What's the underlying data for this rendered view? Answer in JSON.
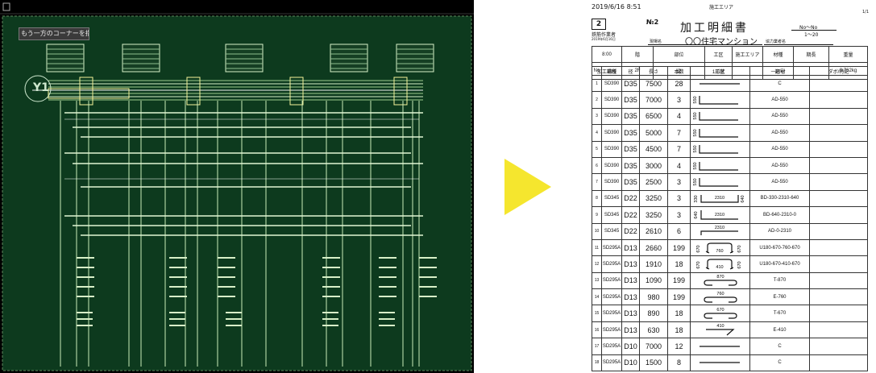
{
  "cad": {
    "prompt": "もう一方のコーナーを指定:",
    "grid_label": "Y1",
    "colors": {
      "background": "#0d3a1e",
      "lines": "#b9e2a8",
      "highlight": "#f5f39a"
    }
  },
  "doc": {
    "datetime": "2019/6/16 8:51",
    "area_label": "施工エリア",
    "page": "1/1",
    "sheet_no": "2",
    "sheet_sub": "鉄筋作業者",
    "sheet_date": "2019年6月16日",
    "num_label": "№2",
    "title": "加工明細書",
    "range_label": "No〜No",
    "range_value": "1〜20",
    "site_label": "現場名",
    "site_name": "〇〇住宅マンション",
    "partner_label": "協力業者名",
    "info_rows": [
      [
        "8:00",
        "階",
        "部位",
        "工区",
        "施工エリア",
        "材種",
        "期長",
        "重量"
      ],
      [
        "加工場所",
        "2F",
        "梁",
        "1工区",
        "",
        "一般材",
        "",
        "3,762kg"
      ]
    ],
    "columns": [
      "No",
      "鋼種",
      "径",
      "長さ",
      "本数",
      "形状",
      "記号",
      "ダボ/特記"
    ],
    "rows": [
      {
        "no": "1",
        "steel": "SD390",
        "dia": "D35",
        "length": "7500",
        "count": "28",
        "shape": "straight",
        "code": "C"
      },
      {
        "no": "2",
        "steel": "SD390",
        "dia": "D35",
        "length": "7000",
        "count": "3",
        "shape": "hook",
        "dim": "550",
        "code": "AD-550"
      },
      {
        "no": "3",
        "steel": "SD390",
        "dia": "D35",
        "length": "6500",
        "count": "4",
        "shape": "hook",
        "dim": "550",
        "code": "AD-550"
      },
      {
        "no": "4",
        "steel": "SD390",
        "dia": "D35",
        "length": "5000",
        "count": "7",
        "shape": "hook",
        "dim": "550",
        "code": "AD-550"
      },
      {
        "no": "5",
        "steel": "SD390",
        "dia": "D35",
        "length": "4500",
        "count": "7",
        "shape": "hook",
        "dim": "550",
        "code": "AD-550"
      },
      {
        "no": "6",
        "steel": "SD390",
        "dia": "D35",
        "length": "3000",
        "count": "4",
        "shape": "hook",
        "dim": "550",
        "code": "AD-550"
      },
      {
        "no": "7",
        "steel": "SD390",
        "dia": "D35",
        "length": "2500",
        "count": "3",
        "shape": "hook",
        "dim": "550",
        "code": "AD-550"
      },
      {
        "no": "8",
        "steel": "SD345",
        "dia": "D22",
        "length": "3250",
        "count": "3",
        "shape": "u",
        "dim": "2310",
        "dim_l": "330",
        "dim_r": "640",
        "code": "BD-330-2310-640"
      },
      {
        "no": "9",
        "steel": "SD345",
        "dia": "D22",
        "length": "3250",
        "count": "3",
        "shape": "l",
        "dim": "2310",
        "dim_l": "640",
        "code": "BD-640-2310-0"
      },
      {
        "no": "10",
        "steel": "SD345",
        "dia": "D22",
        "length": "2610",
        "count": "6",
        "shape": "top",
        "dim": "2310",
        "code": "AD-0-2310"
      },
      {
        "no": "11",
        "steel": "SD295A",
        "dia": "D13",
        "length": "2660",
        "count": "199",
        "shape": "stirrup",
        "dim": "760",
        "dim_l": "670",
        "dim_r": "670",
        "code": "U180-670-760-670"
      },
      {
        "no": "12",
        "steel": "SD295A",
        "dia": "D13",
        "length": "1910",
        "count": "18",
        "shape": "stirrup",
        "dim": "410",
        "dim_l": "670",
        "dim_r": "670",
        "code": "U180-670-410-670"
      },
      {
        "no": "13",
        "steel": "SD295A",
        "dia": "D13",
        "length": "1090",
        "count": "199",
        "shape": "tie",
        "dim": "870",
        "code": "T-870"
      },
      {
        "no": "14",
        "steel": "SD295A",
        "dia": "D13",
        "length": "980",
        "count": "199",
        "shape": "tie",
        "dim": "760",
        "code": "E-760"
      },
      {
        "no": "15",
        "steel": "SD295A",
        "dia": "D13",
        "length": "890",
        "count": "18",
        "shape": "tie",
        "dim": "670",
        "code": "T-670"
      },
      {
        "no": "16",
        "steel": "SD295A",
        "dia": "D13",
        "length": "630",
        "count": "18",
        "shape": "diag",
        "dim": "410",
        "code": "E-410"
      },
      {
        "no": "17",
        "steel": "SD295A",
        "dia": "D10",
        "length": "7000",
        "count": "12",
        "shape": "straight",
        "code": "C"
      },
      {
        "no": "18",
        "steel": "SD295A",
        "dia": "D10",
        "length": "1500",
        "count": "8",
        "shape": "straight",
        "code": "C"
      }
    ]
  },
  "arrow_color": "#f5e62e"
}
